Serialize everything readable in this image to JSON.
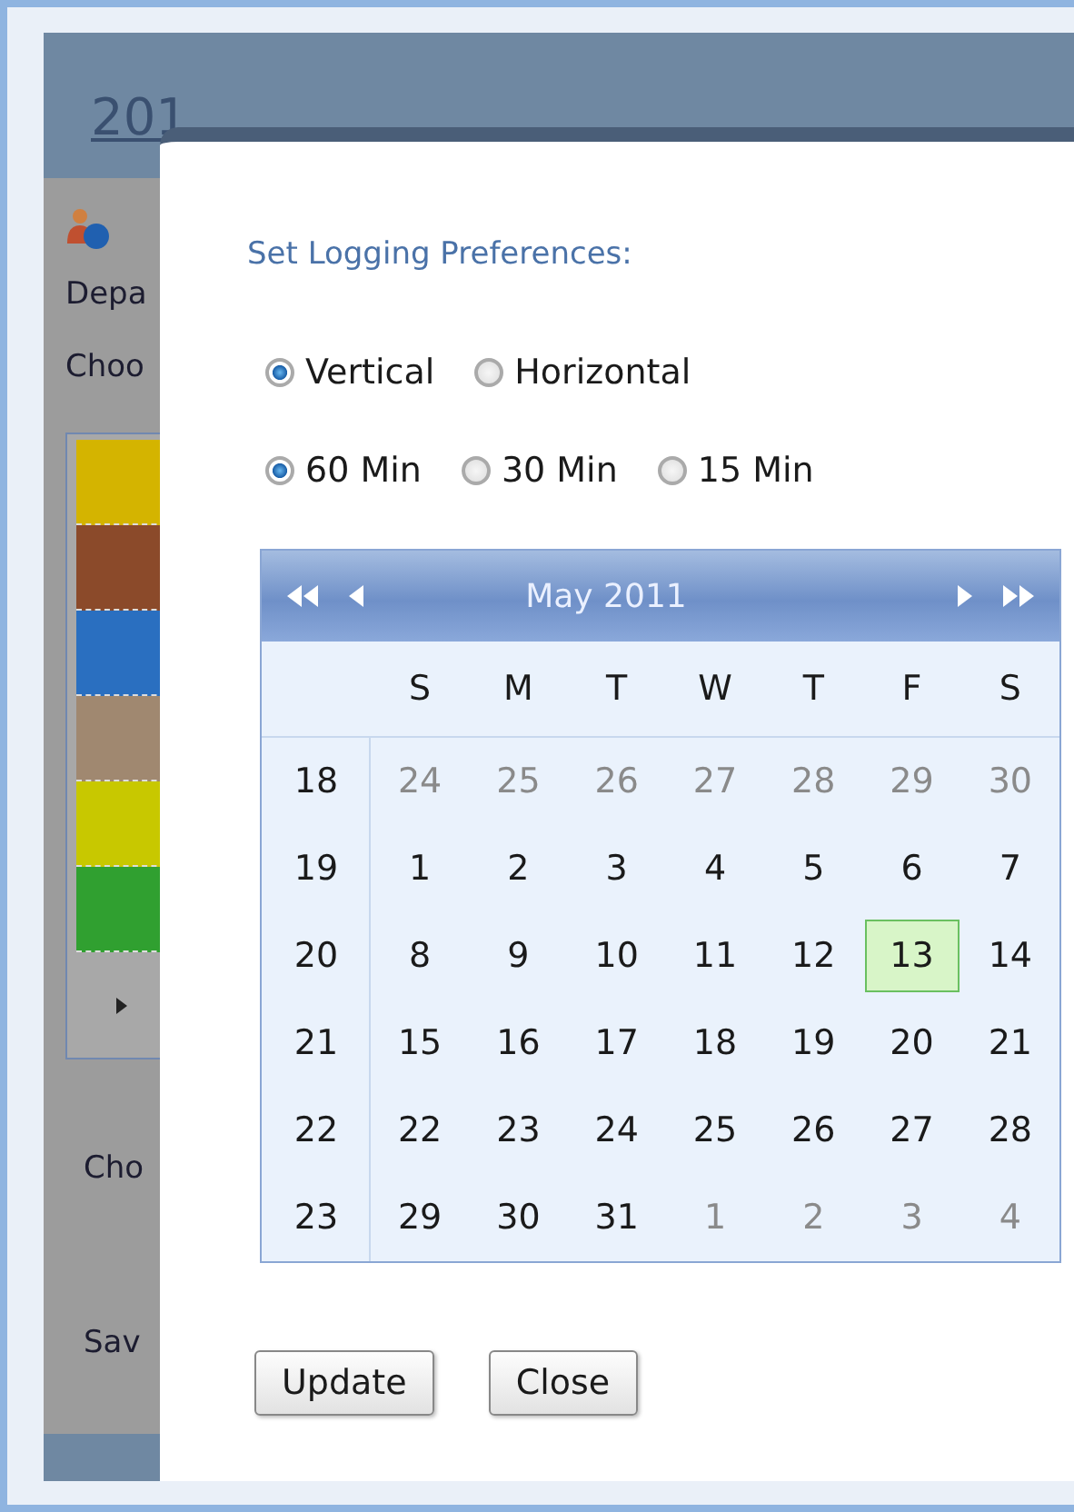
{
  "background": {
    "header_text": "201",
    "labels_top": [
      "Depa",
      "Choo"
    ],
    "swatches": [
      {
        "color": "#d4b400"
      },
      {
        "color": "#8b4a2a"
      },
      {
        "color": "#2a6fc0"
      },
      {
        "color": "#a08870"
      },
      {
        "color": "#c8c800"
      },
      {
        "color": "#30a030"
      }
    ],
    "labels_bottom": [
      "Cho",
      "Sav"
    ]
  },
  "dialog": {
    "title": "Set Logging Preferences:",
    "orientation": [
      {
        "label": "Vertical",
        "selected": true
      },
      {
        "label": "Horizontal",
        "selected": false
      }
    ],
    "interval": [
      {
        "label": "60 Min",
        "selected": true
      },
      {
        "label": "30 Min",
        "selected": false
      },
      {
        "label": "15 Min",
        "selected": false
      }
    ],
    "calendar": {
      "month": "May 2011",
      "weekdays": [
        "S",
        "M",
        "T",
        "W",
        "T",
        "F",
        "S"
      ],
      "weeks": [
        {
          "week": "18",
          "days": [
            {
              "day": "24",
              "other_month": true,
              "selected": false
            },
            {
              "day": "25",
              "other_month": true,
              "selected": false
            },
            {
              "day": "26",
              "other_month": true,
              "selected": false
            },
            {
              "day": "27",
              "other_month": true,
              "selected": false
            },
            {
              "day": "28",
              "other_month": true,
              "selected": false
            },
            {
              "day": "29",
              "other_month": true,
              "selected": false
            },
            {
              "day": "30",
              "other_month": true,
              "selected": false
            }
          ]
        },
        {
          "week": "19",
          "days": [
            {
              "day": "1",
              "other_month": false,
              "selected": false
            },
            {
              "day": "2",
              "other_month": false,
              "selected": false
            },
            {
              "day": "3",
              "other_month": false,
              "selected": false
            },
            {
              "day": "4",
              "other_month": false,
              "selected": false
            },
            {
              "day": "5",
              "other_month": false,
              "selected": false
            },
            {
              "day": "6",
              "other_month": false,
              "selected": false
            },
            {
              "day": "7",
              "other_month": false,
              "selected": false
            }
          ]
        },
        {
          "week": "20",
          "days": [
            {
              "day": "8",
              "other_month": false,
              "selected": false
            },
            {
              "day": "9",
              "other_month": false,
              "selected": false
            },
            {
              "day": "10",
              "other_month": false,
              "selected": false
            },
            {
              "day": "11",
              "other_month": false,
              "selected": false
            },
            {
              "day": "12",
              "other_month": false,
              "selected": false
            },
            {
              "day": "13",
              "other_month": false,
              "selected": true
            },
            {
              "day": "14",
              "other_month": false,
              "selected": false
            }
          ]
        },
        {
          "week": "21",
          "days": [
            {
              "day": "15",
              "other_month": false,
              "selected": false
            },
            {
              "day": "16",
              "other_month": false,
              "selected": false
            },
            {
              "day": "17",
              "other_month": false,
              "selected": false
            },
            {
              "day": "18",
              "other_month": false,
              "selected": false
            },
            {
              "day": "19",
              "other_month": false,
              "selected": false
            },
            {
              "day": "20",
              "other_month": false,
              "selected": false
            },
            {
              "day": "21",
              "other_month": false,
              "selected": false
            }
          ]
        },
        {
          "week": "22",
          "days": [
            {
              "day": "22",
              "other_month": false,
              "selected": false
            },
            {
              "day": "23",
              "other_month": false,
              "selected": false
            },
            {
              "day": "24",
              "other_month": false,
              "selected": false
            },
            {
              "day": "25",
              "other_month": false,
              "selected": false
            },
            {
              "day": "26",
              "other_month": false,
              "selected": false
            },
            {
              "day": "27",
              "other_month": false,
              "selected": false
            },
            {
              "day": "28",
              "other_month": false,
              "selected": false
            }
          ]
        },
        {
          "week": "23",
          "days": [
            {
              "day": "29",
              "other_month": false,
              "selected": false
            },
            {
              "day": "30",
              "other_month": false,
              "selected": false
            },
            {
              "day": "31",
              "other_month": false,
              "selected": false
            },
            {
              "day": "1",
              "other_month": true,
              "selected": false
            },
            {
              "day": "2",
              "other_month": true,
              "selected": false
            },
            {
              "day": "3",
              "other_month": true,
              "selected": false
            },
            {
              "day": "4",
              "other_month": true,
              "selected": false
            }
          ]
        }
      ]
    },
    "buttons": [
      "Update",
      "Close"
    ]
  }
}
